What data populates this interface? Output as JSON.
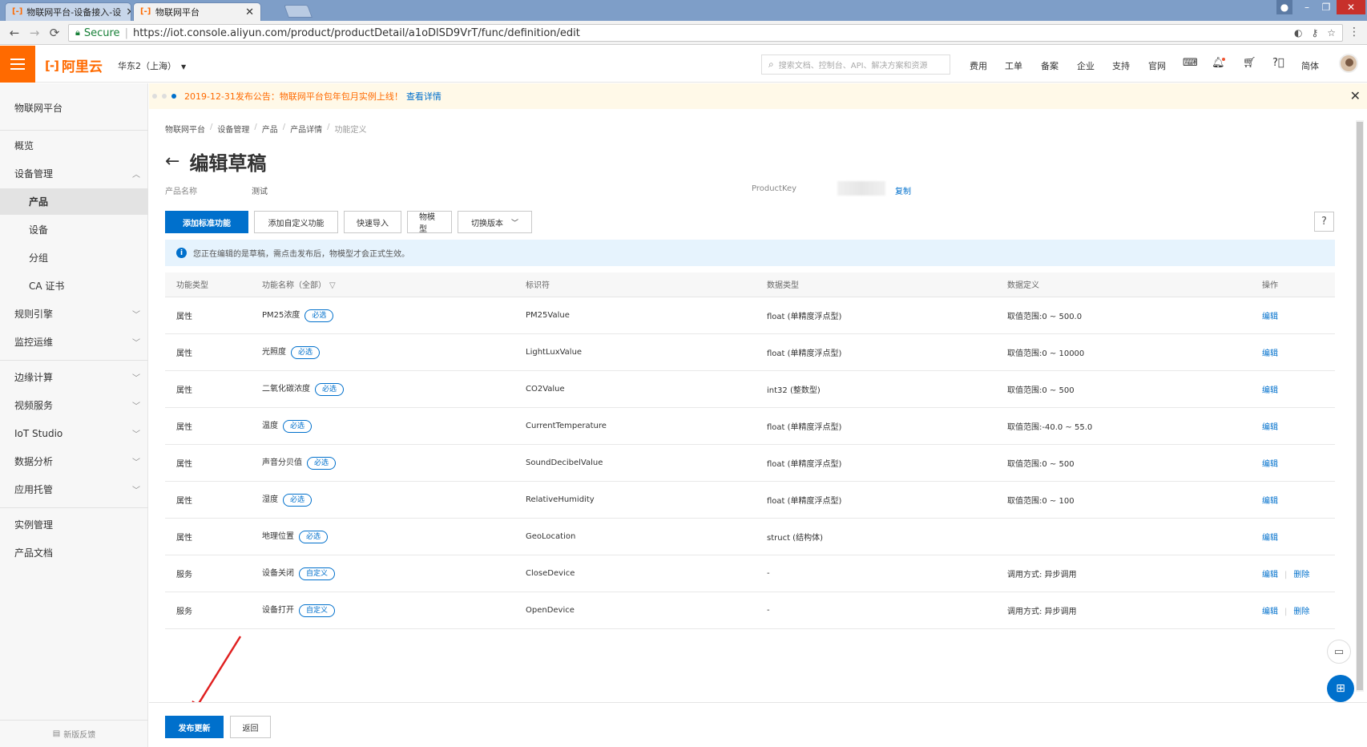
{
  "browser": {
    "tabs": [
      {
        "title": "物联网平台-设备接入-设",
        "active": false
      },
      {
        "title": "物联网平台",
        "active": true
      }
    ],
    "nav": {
      "back": "←",
      "forward": "→",
      "reload": "⟳"
    },
    "address": {
      "secure_label": "Secure",
      "url": "https://iot.console.aliyun.com/product/productDetail/a1oDlSD9VrT/func/definition/edit"
    }
  },
  "topnav": {
    "logo_text": "阿里云",
    "region": "华东2（上海）",
    "search_placeholder": "搜索文档、控制台、API、解决方案和资源",
    "links": [
      "费用",
      "工单",
      "备案",
      "企业",
      "支持",
      "官网"
    ],
    "lang": "简体"
  },
  "sidebar": {
    "title": "物联网平台",
    "items": [
      {
        "label": "概览"
      },
      {
        "label": "设备管理"
      },
      {
        "label": "产品"
      },
      {
        "label": "设备"
      },
      {
        "label": "分组"
      },
      {
        "label": "CA 证书"
      },
      {
        "label": "规则引擎"
      },
      {
        "label": "监控运维"
      },
      {
        "label": "边缘计算"
      },
      {
        "label": "视频服务"
      },
      {
        "label": "IoT Studio"
      },
      {
        "label": "数据分析"
      },
      {
        "label": "应用托管"
      },
      {
        "label": "实例管理"
      },
      {
        "label": "产品文档"
      }
    ],
    "feedback": "新版反馈"
  },
  "notice": {
    "text": "2019-12-31发布公告：物联网平台包年包月实例上线！",
    "link": "查看详情"
  },
  "breadcrumb": [
    "物联网平台",
    "设备管理",
    "产品",
    "产品详情",
    "功能定义"
  ],
  "page": {
    "title": "编辑草稿",
    "product_name_label": "产品名称",
    "product_name_value": "测试",
    "product_key_label": "ProductKey",
    "copy_label": "复制"
  },
  "toolbar": {
    "add_standard": "添加标准功能",
    "add_custom": "添加自定义功能",
    "quick_import": "快速导入",
    "tsl_model": "物模型",
    "switch_version": "切换版本",
    "help": "?"
  },
  "info": {
    "text": "您正在编辑的是草稿，需点击发布后，物模型才会正式生效。"
  },
  "table": {
    "headers": {
      "type": "功能类型",
      "name": "功能名称（全部）",
      "identifier": "标识符",
      "data_type": "数据类型",
      "data_def": "数据定义",
      "ops": "操作"
    },
    "edit_label": "编辑",
    "delete_label": "删除",
    "rows": [
      {
        "type": "属性",
        "name": "PM25浓度",
        "tag": "必选",
        "identifier": "PM25Value",
        "data_type": "float (单精度浮点型)",
        "data_def": "取值范围:0 ~ 500.0"
      },
      {
        "type": "属性",
        "name": "光照度",
        "tag": "必选",
        "identifier": "LightLuxValue",
        "data_type": "float (单精度浮点型)",
        "data_def": "取值范围:0 ~ 10000"
      },
      {
        "type": "属性",
        "name": "二氧化碳浓度",
        "tag": "必选",
        "identifier": "CO2Value",
        "data_type": "int32 (整数型)",
        "data_def": "取值范围:0 ~ 500"
      },
      {
        "type": "属性",
        "name": "温度",
        "tag": "必选",
        "identifier": "CurrentTemperature",
        "data_type": "float (单精度浮点型)",
        "data_def": "取值范围:-40.0 ~ 55.0"
      },
      {
        "type": "属性",
        "name": "声音分贝值",
        "tag": "必选",
        "identifier": "SoundDecibelValue",
        "data_type": "float (单精度浮点型)",
        "data_def": "取值范围:0 ~ 500"
      },
      {
        "type": "属性",
        "name": "湿度",
        "tag": "必选",
        "identifier": "RelativeHumidity",
        "data_type": "float (单精度浮点型)",
        "data_def": "取值范围:0 ~ 100"
      },
      {
        "type": "属性",
        "name": "地理位置",
        "tag": "必选",
        "identifier": "GeoLocation",
        "data_type": "struct (结构体)",
        "data_def": ""
      },
      {
        "type": "服务",
        "name": "设备关闭",
        "tag": "自定义",
        "identifier": "CloseDevice",
        "data_type": "-",
        "data_def": "调用方式: 异步调用"
      },
      {
        "type": "服务",
        "name": "设备打开",
        "tag": "自定义",
        "identifier": "OpenDevice",
        "data_type": "-",
        "data_def": "调用方式: 异步调用"
      }
    ]
  },
  "footer": {
    "publish": "发布更新",
    "back": "返回"
  },
  "colors": {
    "brand": "#ff6a00",
    "primary": "#0070cc",
    "annotation_arrow": "#e02020"
  }
}
